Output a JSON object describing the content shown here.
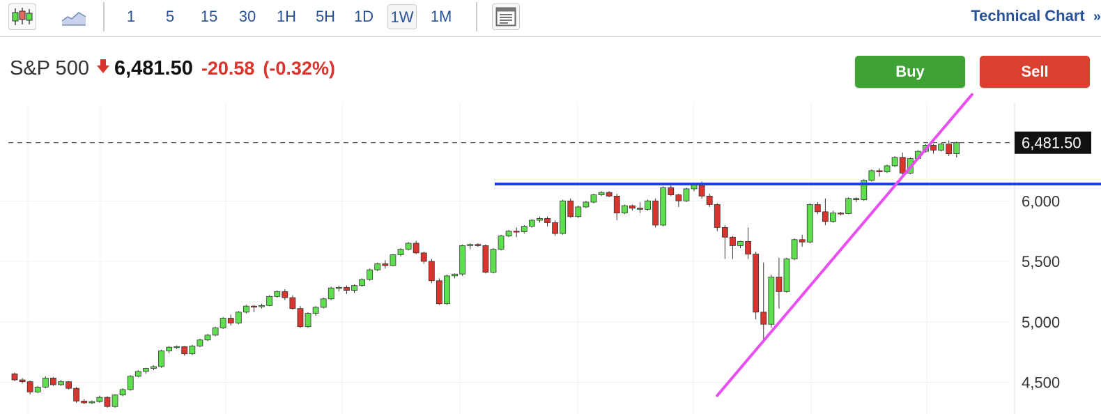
{
  "toolbar": {
    "chart_type_icon": "candlestick-icon",
    "line_type_icon": "line-chart-icon",
    "layout_icon": "layout-panel-icon",
    "timeframes": [
      "1",
      "5",
      "15",
      "30",
      "1H",
      "5H",
      "1D",
      "1W",
      "1M"
    ],
    "active_timeframe": "1W",
    "tech_link": "Technical Chart",
    "tech_link_icon": "double-chevron-right-icon"
  },
  "quote": {
    "name": "S&P 500",
    "direction_icon": "down-arrow-icon",
    "last": "6,481.50",
    "change": "-20.58",
    "change_pct": "(-0.32%)"
  },
  "actions": {
    "buy": "Buy",
    "sell": "Sell"
  },
  "colors": {
    "up": "#5ee04e",
    "down": "#d9352e",
    "support_line": "#1f3fe6",
    "trend_line": "#e84ff0",
    "buy": "#3ea234",
    "sell": "#d9402f"
  },
  "chart_data": {
    "type": "candlestick",
    "y_ticks": [
      4500,
      5000,
      5500,
      6000
    ],
    "y_tick_labels": [
      "4,500",
      "5,000",
      "5,500",
      "6,000"
    ],
    "last_price": 6481.5,
    "last_price_label": "6,481.50",
    "candles": [
      [
        4570,
        4580,
        4510,
        4520
      ],
      [
        4520,
        4535,
        4490,
        4505
      ],
      [
        4505,
        4515,
        4400,
        4420
      ],
      [
        4420,
        4470,
        4410,
        4460
      ],
      [
        4460,
        4550,
        4450,
        4535
      ],
      [
        4535,
        4545,
        4470,
        4480
      ],
      [
        4480,
        4520,
        4470,
        4505
      ],
      [
        4505,
        4510,
        4440,
        4450
      ],
      [
        4450,
        4460,
        4330,
        4345
      ],
      [
        4345,
        4360,
        4320,
        4330
      ],
      [
        4330,
        4350,
        4320,
        4340
      ],
      [
        4340,
        4390,
        4330,
        4375
      ],
      [
        4375,
        4385,
        4290,
        4300
      ],
      [
        4300,
        4400,
        4290,
        4395
      ],
      [
        4395,
        4450,
        4385,
        4440
      ],
      [
        4440,
        4560,
        4430,
        4550
      ],
      [
        4550,
        4600,
        4540,
        4590
      ],
      [
        4590,
        4620,
        4570,
        4615
      ],
      [
        4615,
        4640,
        4600,
        4630
      ],
      [
        4630,
        4770,
        4620,
        4760
      ],
      [
        4760,
        4800,
        4740,
        4790
      ],
      [
        4790,
        4805,
        4775,
        4795
      ],
      [
        4795,
        4800,
        4720,
        4735
      ],
      [
        4735,
        4810,
        4725,
        4800
      ],
      [
        4800,
        4860,
        4790,
        4850
      ],
      [
        4850,
        4900,
        4840,
        4890
      ],
      [
        4890,
        4960,
        4880,
        4950
      ],
      [
        4950,
        5040,
        4940,
        5030
      ],
      [
        5030,
        5060,
        4970,
        4990
      ],
      [
        4990,
        5090,
        4980,
        5080
      ],
      [
        5080,
        5140,
        5070,
        5130
      ],
      [
        5130,
        5140,
        5080,
        5125
      ],
      [
        5125,
        5150,
        5110,
        5135
      ],
      [
        5135,
        5220,
        5130,
        5210
      ],
      [
        5210,
        5260,
        5200,
        5250
      ],
      [
        5250,
        5270,
        5180,
        5200
      ],
      [
        5200,
        5220,
        5100,
        5110
      ],
      [
        5110,
        5130,
        4950,
        4960
      ],
      [
        4960,
        5080,
        4950,
        5070
      ],
      [
        5070,
        5130,
        5050,
        5120
      ],
      [
        5120,
        5200,
        5110,
        5190
      ],
      [
        5190,
        5290,
        5180,
        5280
      ],
      [
        5280,
        5300,
        5250,
        5285
      ],
      [
        5285,
        5300,
        5230,
        5260
      ],
      [
        5260,
        5310,
        5240,
        5300
      ],
      [
        5300,
        5360,
        5290,
        5350
      ],
      [
        5350,
        5440,
        5340,
        5430
      ],
      [
        5430,
        5490,
        5420,
        5480
      ],
      [
        5480,
        5510,
        5440,
        5465
      ],
      [
        5465,
        5560,
        5460,
        5555
      ],
      [
        5555,
        5610,
        5540,
        5600
      ],
      [
        5600,
        5660,
        5590,
        5650
      ],
      [
        5650,
        5670,
        5560,
        5570
      ],
      [
        5570,
        5580,
        5480,
        5500
      ],
      [
        5500,
        5520,
        5320,
        5340
      ],
      [
        5340,
        5360,
        5140,
        5150
      ],
      [
        5150,
        5390,
        5140,
        5380
      ],
      [
        5380,
        5400,
        5360,
        5395
      ],
      [
        5395,
        5640,
        5380,
        5630
      ],
      [
        5630,
        5650,
        5600,
        5640
      ],
      [
        5640,
        5650,
        5620,
        5630
      ],
      [
        5630,
        5640,
        5400,
        5410
      ],
      [
        5410,
        5610,
        5400,
        5600
      ],
      [
        5600,
        5720,
        5590,
        5710
      ],
      [
        5710,
        5760,
        5700,
        5750
      ],
      [
        5750,
        5780,
        5700,
        5745
      ],
      [
        5745,
        5800,
        5730,
        5790
      ],
      [
        5790,
        5850,
        5780,
        5840
      ],
      [
        5840,
        5870,
        5820,
        5855
      ],
      [
        5855,
        5870,
        5790,
        5820
      ],
      [
        5820,
        5840,
        5710,
        5730
      ],
      [
        5730,
        6010,
        5720,
        6000
      ],
      [
        6000,
        6020,
        5860,
        5870
      ],
      [
        5870,
        5960,
        5860,
        5950
      ],
      [
        5950,
        6000,
        5940,
        5990
      ],
      [
        5990,
        6060,
        5980,
        6050
      ],
      [
        6050,
        6080,
        6040,
        6070
      ],
      [
        6070,
        6080,
        6030,
        6040
      ],
      [
        6040,
        6060,
        5840,
        5900
      ],
      [
        5900,
        5970,
        5890,
        5960
      ],
      [
        5960,
        5970,
        5920,
        5940
      ],
      [
        5940,
        5990,
        5900,
        5930
      ],
      [
        5930,
        6010,
        5920,
        6000
      ],
      [
        6000,
        6020,
        5780,
        5800
      ],
      [
        5800,
        6120,
        5790,
        6110
      ],
      [
        6110,
        6130,
        6040,
        6050
      ],
      [
        6050,
        6060,
        5950,
        6000
      ],
      [
        6000,
        6110,
        5990,
        6100
      ],
      [
        6100,
        6140,
        6080,
        6130
      ],
      [
        6130,
        6160,
        6020,
        6040
      ],
      [
        6040,
        6060,
        5950,
        5970
      ],
      [
        5970,
        5980,
        5750,
        5780
      ],
      [
        5780,
        5800,
        5520,
        5700
      ],
      [
        5700,
        5710,
        5520,
        5630
      ],
      [
        5630,
        5670,
        5610,
        5665
      ],
      [
        5665,
        5780,
        5520,
        5560
      ],
      [
        5560,
        5580,
        5020,
        5080
      ],
      [
        5080,
        5490,
        4840,
        4980
      ],
      [
        4980,
        5390,
        4950,
        5370
      ],
      [
        5370,
        5530,
        5110,
        5250
      ],
      [
        5250,
        5530,
        5240,
        5520
      ],
      [
        5520,
        5690,
        5510,
        5680
      ],
      [
        5680,
        5720,
        5620,
        5660
      ],
      [
        5660,
        5980,
        5650,
        5970
      ],
      [
        5970,
        5990,
        5890,
        5910
      ],
      [
        5910,
        6020,
        5800,
        5830
      ],
      [
        5830,
        5920,
        5820,
        5900
      ],
      [
        5900,
        5910,
        5880,
        5895
      ],
      [
        5895,
        6030,
        5890,
        6020
      ],
      [
        6020,
        6030,
        5990,
        6010
      ],
      [
        6010,
        6180,
        6000,
        6170
      ],
      [
        6170,
        6260,
        6160,
        6250
      ],
      [
        6250,
        6270,
        6200,
        6240
      ],
      [
        6240,
        6300,
        6230,
        6290
      ],
      [
        6290,
        6370,
        6280,
        6360
      ],
      [
        6360,
        6400,
        6200,
        6230
      ],
      [
        6230,
        6360,
        6220,
        6350
      ],
      [
        6350,
        6420,
        6340,
        6410
      ],
      [
        6410,
        6470,
        6400,
        6460
      ],
      [
        6460,
        6470,
        6390,
        6420
      ],
      [
        6420,
        6480,
        6410,
        6470
      ],
      [
        6470,
        6500,
        6370,
        6390
      ],
      [
        6390,
        6490,
        6360,
        6481.5
      ]
    ],
    "support_line_level": 6140,
    "trend_line": {
      "from": {
        "candle": 91,
        "price": 4390
      },
      "to": {
        "candle": 124,
        "price": 6880
      }
    }
  }
}
